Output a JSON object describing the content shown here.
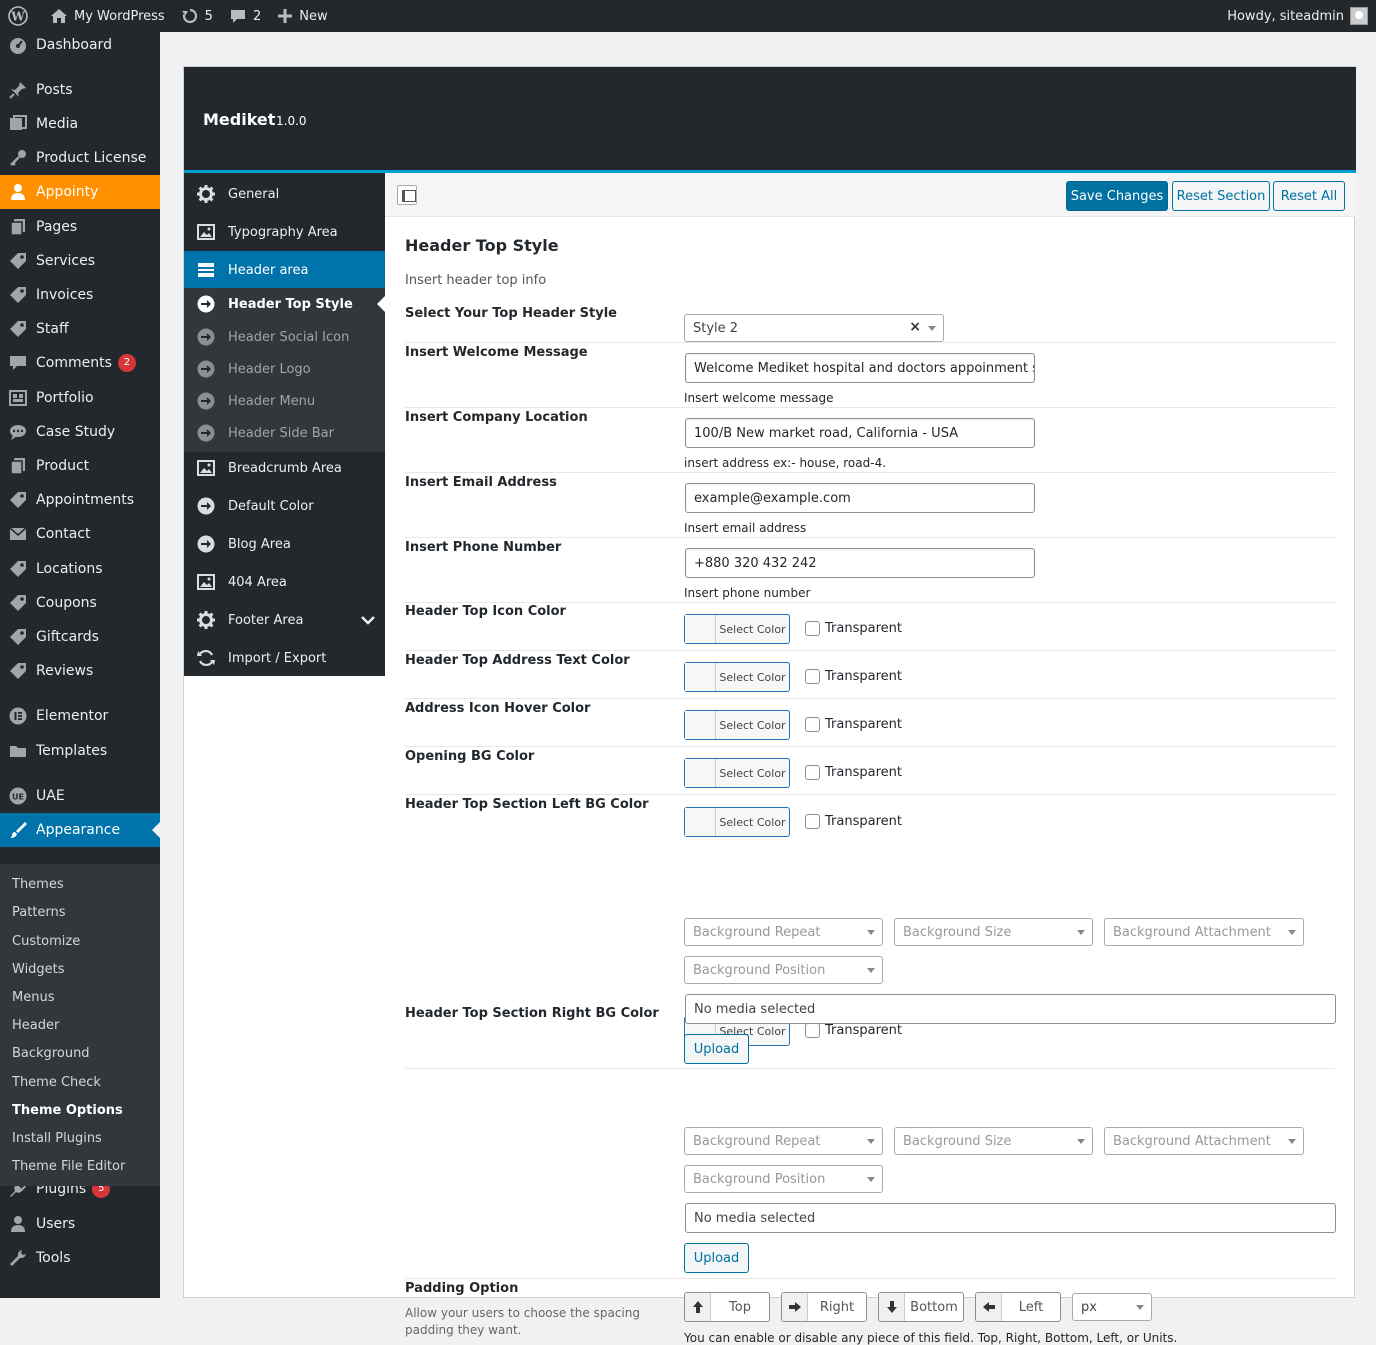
{
  "adminbar": {
    "site_name": "My WordPress",
    "updates_count": "5",
    "comments_count": "2",
    "new_label": "New",
    "howdy": "Howdy, siteadmin"
  },
  "adminmenu": {
    "items": [
      {
        "label": "Dashboard",
        "icon": "dashboard-icon"
      },
      {
        "label": "Posts",
        "icon": "pin-icon"
      },
      {
        "label": "Media",
        "icon": "media-icon"
      },
      {
        "label": "Product License",
        "icon": "key-icon"
      },
      {
        "label": "Appointy",
        "icon": "user-icon"
      },
      {
        "label": "Pages",
        "icon": "pages-icon"
      },
      {
        "label": "Services",
        "icon": "tag-icon"
      },
      {
        "label": "Invoices",
        "icon": "tag-icon"
      },
      {
        "label": "Staff",
        "icon": "tag-icon"
      },
      {
        "label": "Comments",
        "icon": "comment-icon",
        "badge": "2"
      },
      {
        "label": "Portfolio",
        "icon": "portfolio-icon"
      },
      {
        "label": "Case Study",
        "icon": "chat-icon"
      },
      {
        "label": "Product",
        "icon": "pages-icon"
      },
      {
        "label": "Appointments",
        "icon": "tag-icon"
      },
      {
        "label": "Contact",
        "icon": "mail-icon"
      },
      {
        "label": "Locations",
        "icon": "tag-icon"
      },
      {
        "label": "Coupons",
        "icon": "tag-icon"
      },
      {
        "label": "Giftcards",
        "icon": "tag-icon"
      },
      {
        "label": "Reviews",
        "icon": "tag-icon"
      },
      {
        "label": "Elementor",
        "icon": "elementor-icon"
      },
      {
        "label": "Templates",
        "icon": "folder-icon"
      },
      {
        "label": "UAE",
        "icon": "uae-icon"
      },
      {
        "label": "Appearance",
        "icon": "brush-icon"
      },
      {
        "label": "Plugins",
        "icon": "plugin-icon",
        "badge": "5"
      },
      {
        "label": "Users",
        "icon": "users-icon"
      },
      {
        "label": "Tools",
        "icon": "wrench-icon"
      }
    ],
    "appearance_submenu": [
      "Themes",
      "Patterns",
      "Customize",
      "Widgets",
      "Menus",
      "Header",
      "Background",
      "Theme Check",
      "Theme Options",
      "Install Plugins",
      "Theme File Editor"
    ]
  },
  "panel": {
    "theme_name": "Mediket",
    "theme_version": "1.0.0",
    "sidebar": {
      "items": [
        "General",
        "Typography Area",
        "Header area",
        "Breadcrumb Area",
        "Default Color",
        "Blog Area",
        "404 Area",
        "Footer Area",
        "Import / Export"
      ],
      "sub_items": [
        "Header Top Style",
        "Header Social Icon",
        "Header Logo",
        "Header Menu",
        "Header Side Bar"
      ]
    },
    "buttons": {
      "save": "Save Changes",
      "reset_section": "Reset Section",
      "reset_all": "Reset All"
    },
    "section": {
      "title": "Header Top Style",
      "description": "Insert header top info"
    },
    "fields": {
      "style_label": "Select Your Top Header Style",
      "style_value": "Style 2",
      "welcome_label": "Insert Welcome Message",
      "welcome_value": "Welcome Mediket hospital and doctors appoinment se",
      "welcome_desc": "Insert welcome message",
      "location_label": "Insert Company Location",
      "location_value": "100/B New market road, California - USA",
      "location_desc": "insert address ex:- house, road-4.",
      "email_label": "Insert Email Address",
      "email_value": "example@example.com",
      "email_desc": "Insert email address",
      "phone_label": "Insert Phone Number",
      "phone_value": "+880 320 432 242",
      "phone_desc": "Insert phone number",
      "color_fields": [
        "Header Top Icon Color",
        "Header Top Address Text Color",
        "Address Icon Hover Color",
        "Opening BG Color",
        "Header Top Section Left BG Color",
        "Header Top Section Right BG Color"
      ],
      "select_color": "Select Color",
      "transparent": "Transparent",
      "bg_repeat": "Background Repeat",
      "bg_size": "Background Size",
      "bg_attachment": "Background Attachment",
      "bg_position": "Background Position",
      "no_media": "No media selected",
      "upload": "Upload",
      "padding_label": "Padding Option",
      "padding_desc": "Allow your users to choose the spacing padding they want.",
      "pad_top": "Top",
      "pad_right": "Right",
      "pad_bottom": "Bottom",
      "pad_left": "Left",
      "pad_unit": "px",
      "padding_note": "You can enable or disable any piece of this field. Top, Right, Bottom, Left, or Units."
    }
  },
  "colors": {
    "adminbar_bg": "#23282d",
    "accent_blue": "#0073aa",
    "appointy_orange": "#ff9000",
    "badge_red": "#d63638"
  }
}
